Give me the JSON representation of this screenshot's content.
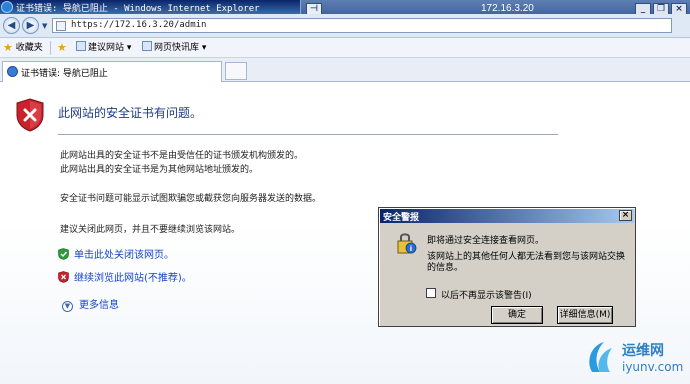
{
  "window": {
    "title": "证书错误: 导航已阻止 - Windows Internet Explorer",
    "rdp_host": "172.16.3.20"
  },
  "address": {
    "url": "https://172.16.3.20/admin"
  },
  "favorites": {
    "label": "收藏夹",
    "suggested": "建议网站",
    "slices": "网页快讯库"
  },
  "tab": {
    "label": "证书错误: 导航已阻止"
  },
  "page": {
    "title": "此网站的安全证书有问题。",
    "para1_line1": "此网站出具的安全证书不是由受信任的证书颁发机构颁发的。",
    "para1_line2": "此网站出具的安全证书是为其他网站地址颁发的。",
    "para2": "安全证书问题可能显示试图欺骗您或截获您向服务器发送的数据。",
    "para3": "建议关闭此网页，并且不要继续浏览该网站。",
    "link_close": "单击此处关闭该网页。",
    "link_continue": "继续浏览此网站(不推荐)。",
    "more_info": "更多信息"
  },
  "dialog": {
    "title": "安全警报",
    "message1": "即将通过安全连接查看网页。",
    "message2": "该网站上的其他任何人都无法看到您与该网站交换的信息。",
    "checkbox_label": "以后不再显示该警告(I)",
    "ok_label": "确定",
    "details_label": "详细信息(M)"
  },
  "watermark": {
    "text1": "运维网",
    "text2": "iyunv.com"
  }
}
